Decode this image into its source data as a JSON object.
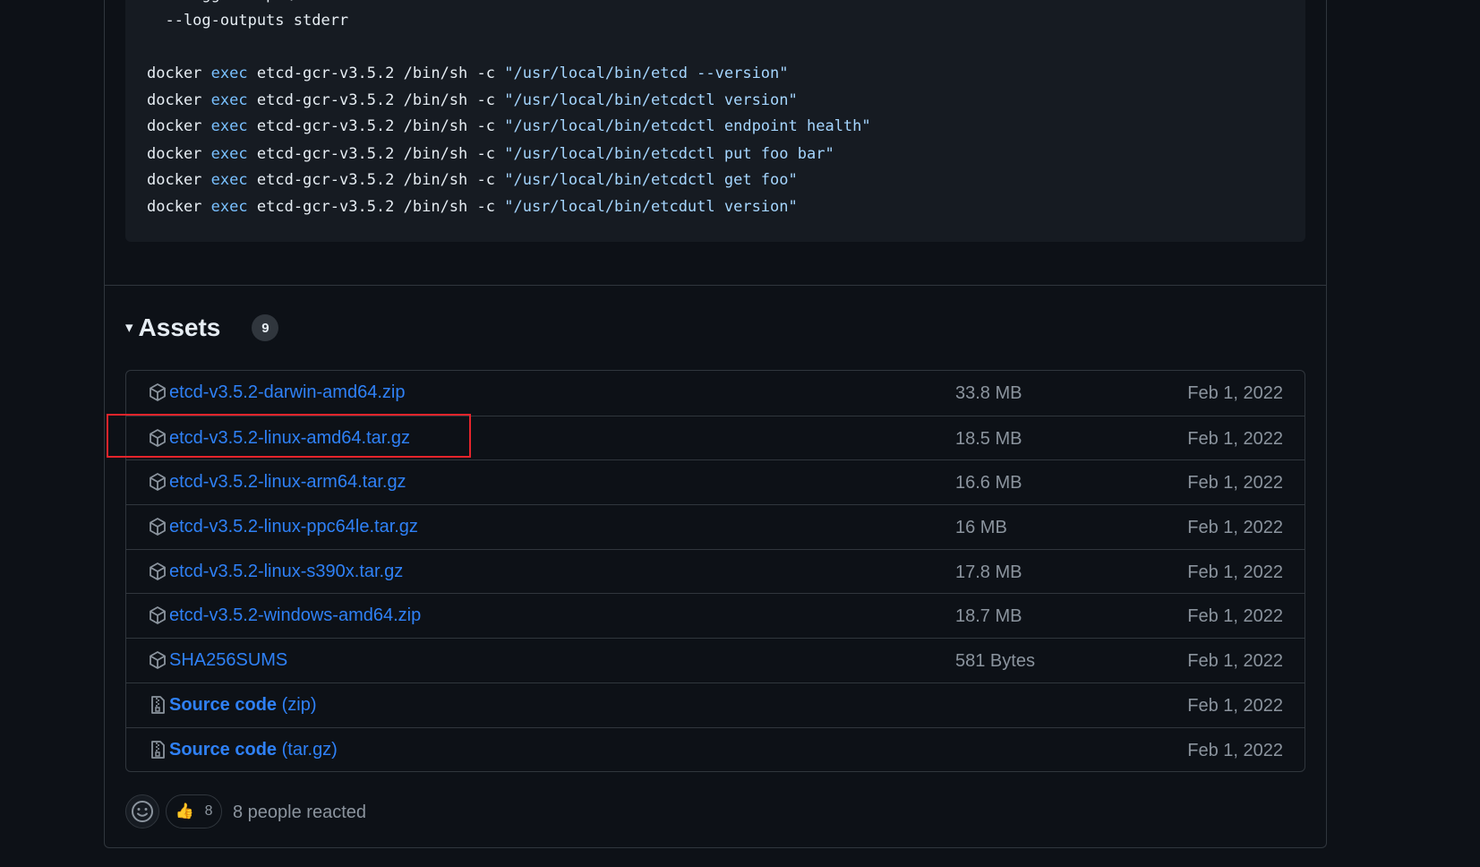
{
  "code": {
    "lines": [
      {
        "plain": "  --logger zap \\"
      },
      {
        "plain": "  --log-outputs stderr"
      },
      {
        "cmd": "docker",
        "kw": "exec",
        "rest": "etcd-gcr-v3.5.2 /bin/sh -c",
        "str": "\"/usr/local/bin/etcd --version\""
      },
      {
        "cmd": "docker",
        "kw": "exec",
        "rest": "etcd-gcr-v3.5.2 /bin/sh -c",
        "str": "\"/usr/local/bin/etcdctl version\""
      },
      {
        "cmd": "docker",
        "kw": "exec",
        "rest": "etcd-gcr-v3.5.2 /bin/sh -c",
        "str": "\"/usr/local/bin/etcdctl endpoint health\""
      },
      {
        "cmd": "docker",
        "kw": "exec",
        "rest": "etcd-gcr-v3.5.2 /bin/sh -c",
        "str": "\"/usr/local/bin/etcdctl put foo bar\""
      },
      {
        "cmd": "docker",
        "kw": "exec",
        "rest": "etcd-gcr-v3.5.2 /bin/sh -c",
        "str": "\"/usr/local/bin/etcdctl get foo\""
      },
      {
        "cmd": "docker",
        "kw": "exec",
        "rest": "etcd-gcr-v3.5.2 /bin/sh -c",
        "str": "\"/usr/local/bin/etcdutl version\""
      }
    ]
  },
  "assets": {
    "toggle": "▾",
    "title": "Assets",
    "count": "9",
    "items": [
      {
        "name": "etcd-v3.5.2-darwin-amd64.zip",
        "size": "33.8 MB",
        "date": "Feb 1, 2022",
        "icon": "package-icon"
      },
      {
        "name": "etcd-v3.5.2-linux-amd64.tar.gz",
        "size": "18.5 MB",
        "date": "Feb 1, 2022",
        "icon": "package-icon",
        "highlighted": true
      },
      {
        "name": "etcd-v3.5.2-linux-arm64.tar.gz",
        "size": "16.6 MB",
        "date": "Feb 1, 2022",
        "icon": "package-icon"
      },
      {
        "name": "etcd-v3.5.2-linux-ppc64le.tar.gz",
        "size": "16 MB",
        "date": "Feb 1, 2022",
        "icon": "package-icon"
      },
      {
        "name": "etcd-v3.5.2-linux-s390x.tar.gz",
        "size": "17.8 MB",
        "date": "Feb 1, 2022",
        "icon": "package-icon"
      },
      {
        "name": "etcd-v3.5.2-windows-amd64.zip",
        "size": "18.7 MB",
        "date": "Feb 1, 2022",
        "icon": "package-icon"
      },
      {
        "name": "SHA256SUMS",
        "size": "581 Bytes",
        "date": "Feb 1, 2022",
        "icon": "package-icon"
      },
      {
        "name": "Source code",
        "sub": "(zip)",
        "size": "",
        "date": "Feb 1, 2022",
        "icon": "file-zip-icon"
      },
      {
        "name": "Source code",
        "sub": "(tar.gz)",
        "size": "",
        "date": "Feb 1, 2022",
        "icon": "file-zip-icon"
      }
    ]
  },
  "reactions": {
    "thumbs_up_count": "8",
    "summary": "8 people reacted"
  },
  "colors": {
    "link": "#2f81f7",
    "highlight": "#e5242b",
    "background": "#0d1117"
  }
}
